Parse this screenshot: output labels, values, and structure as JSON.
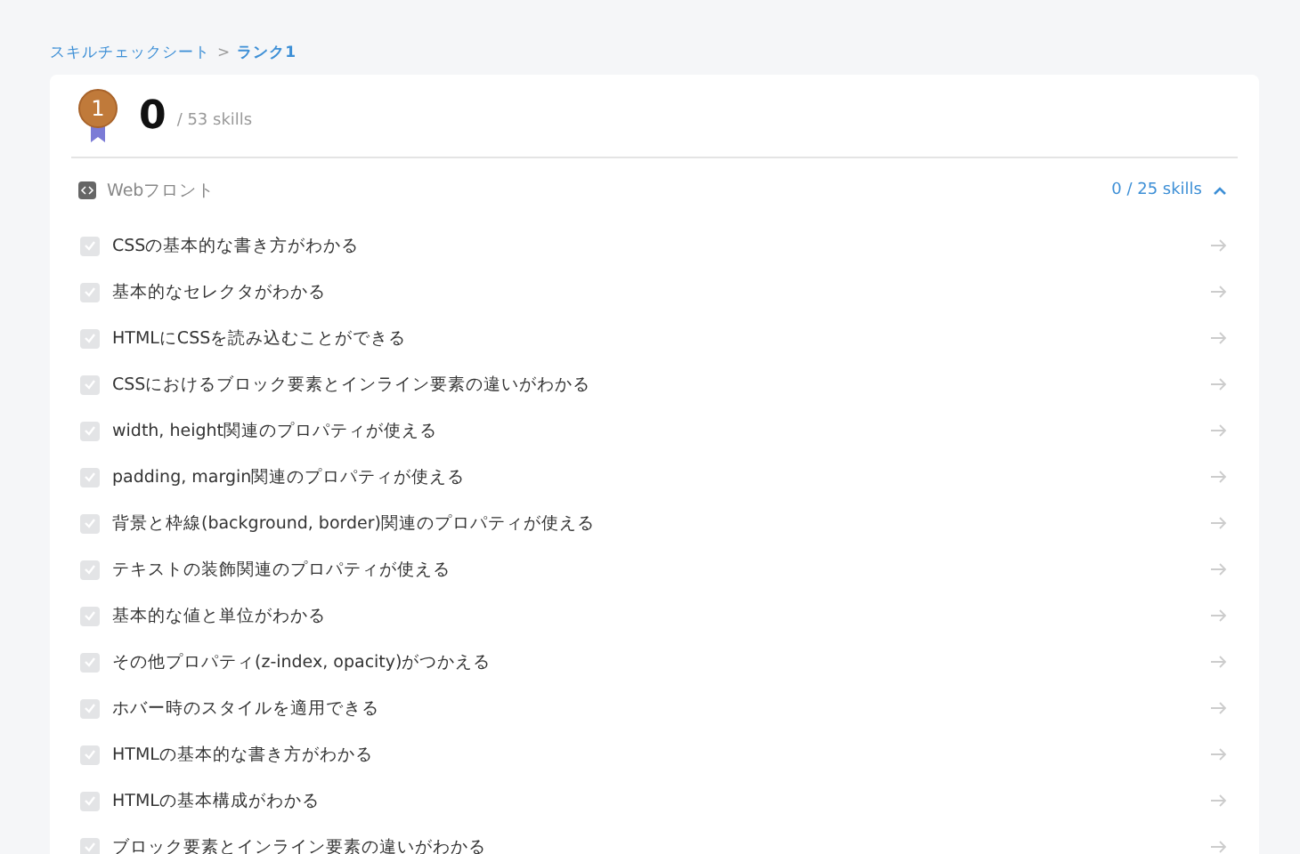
{
  "breadcrumb": {
    "parent": "スキルチェックシート",
    "separator": ">",
    "current": "ランク1"
  },
  "summary": {
    "medal": "1",
    "count": "0",
    "total": "/ 53 skills"
  },
  "section": {
    "title": "Webフロント",
    "progress": "0 / 25 skills",
    "expanded": true,
    "skills": [
      {
        "label": "CSSの基本的な書き方がわかる",
        "checked": false
      },
      {
        "label": "基本的なセレクタがわかる",
        "checked": false
      },
      {
        "label": "HTMLにCSSを読み込むことができる",
        "checked": false
      },
      {
        "label": "CSSにおけるブロック要素とインライン要素の違いがわかる",
        "checked": false
      },
      {
        "label": "width, height関連のプロパティが使える",
        "checked": false
      },
      {
        "label": "padding, margin関連のプロパティが使える",
        "checked": false
      },
      {
        "label": "背景と枠線(background, border)関連のプロパティが使える",
        "checked": false
      },
      {
        "label": "テキストの装飾関連のプロパティが使える",
        "checked": false
      },
      {
        "label": "基本的な値と単位がわかる",
        "checked": false
      },
      {
        "label": "その他プロパティ(z-index, opacity)がつかえる",
        "checked": false
      },
      {
        "label": "ホバー時のスタイルを適用できる",
        "checked": false
      },
      {
        "label": "HTMLの基本的な書き方がわかる",
        "checked": false
      },
      {
        "label": "HTMLの基本構成がわかる",
        "checked": false
      },
      {
        "label": "ブロック要素とインライン要素の違いがわかる",
        "checked": false
      }
    ]
  }
}
